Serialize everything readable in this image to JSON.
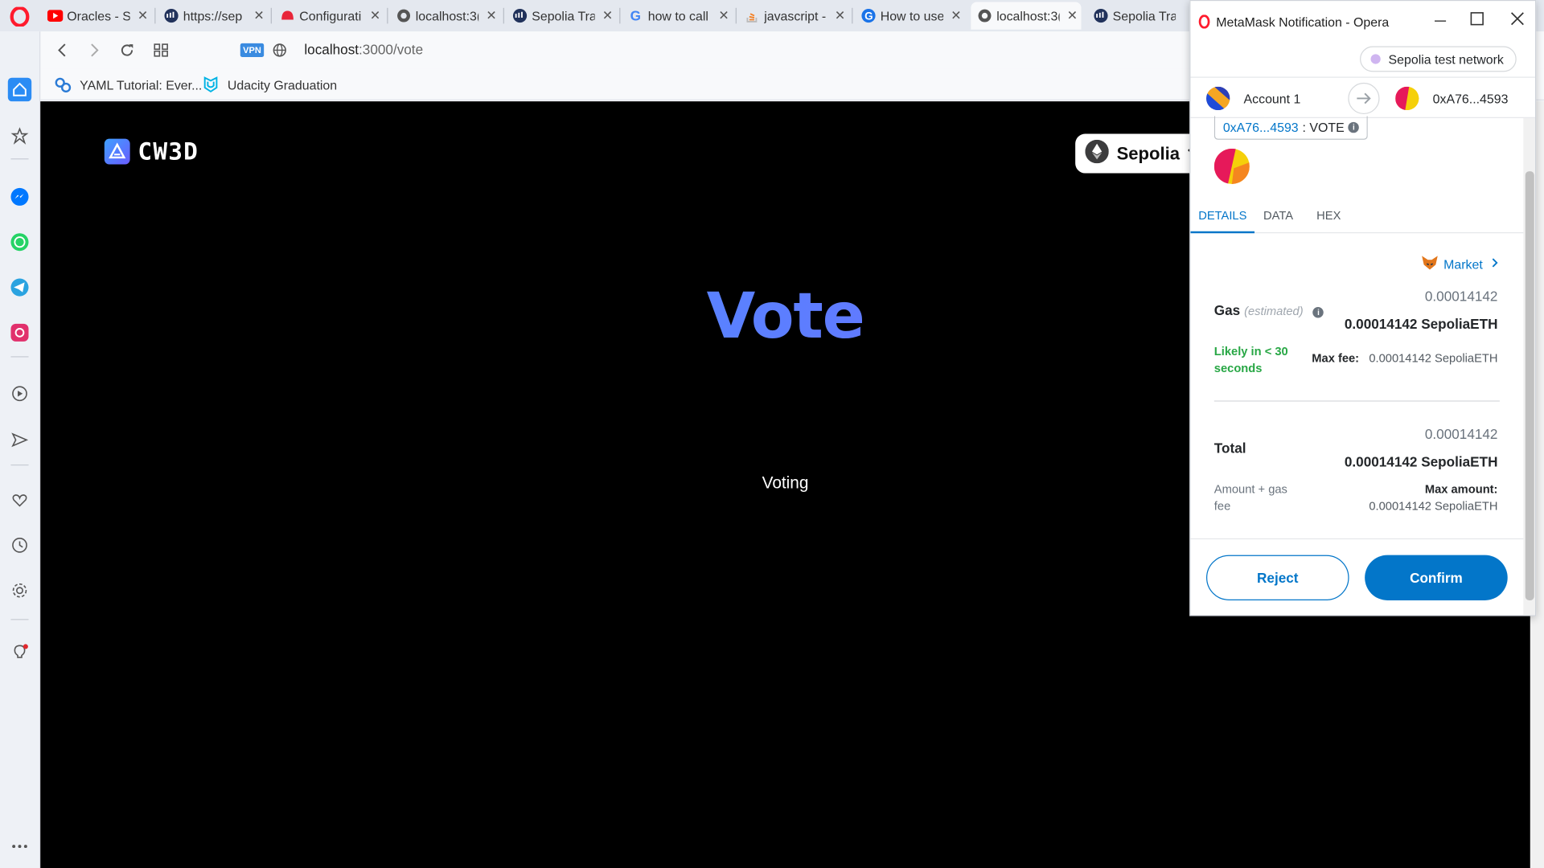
{
  "browser": {
    "tabs": [
      {
        "label": "Oracles - S",
        "icon": "youtube-icon"
      },
      {
        "label": "https://sep",
        "icon": "etherscan-icon"
      },
      {
        "label": "Configurati",
        "icon": "hardhat-icon"
      },
      {
        "label": "localhost:3(",
        "icon": "globe-icon"
      },
      {
        "label": "Sepolia Tra",
        "icon": "etherscan-icon"
      },
      {
        "label": "how to call",
        "icon": "google-icon"
      },
      {
        "label": "javascript -",
        "icon": "stackoverflow-icon"
      },
      {
        "label": "How to use",
        "icon": "google-icon"
      },
      {
        "label": "localhost:3(",
        "icon": "globe-icon"
      },
      {
        "label": "Sepolia Tra",
        "icon": "etherscan-icon"
      }
    ],
    "url_host": "localhost",
    "url_path": ":3000/vote",
    "vpn_label": "VPN",
    "bookmarks": [
      {
        "label": "YAML Tutorial: Ever..."
      },
      {
        "label": "Udacity Graduation"
      }
    ]
  },
  "page": {
    "logo_text": "CW3D",
    "network_label": "Sepolia",
    "title": "Vote",
    "status": "Voting"
  },
  "metamask": {
    "window_title": "MetaMask Notification - Opera",
    "network": "Sepolia test network",
    "from_account": "Account 1",
    "to_account": "0xA76...4593",
    "contract_address": "0xA76...4593",
    "contract_method": ": VOTE",
    "tabs": [
      "DETAILS",
      "DATA",
      "HEX"
    ],
    "market_label": "Market",
    "gas_label": "Gas",
    "gas_estimated": "(estimated)",
    "gas_sub": "0.00014142",
    "gas_main": "0.00014142 SepoliaETH",
    "likely_text": "Likely in < 30 seconds",
    "max_fee_label": "Max fee:",
    "max_fee_value": "0.00014142 SepoliaETH",
    "total_label": "Total",
    "total_sub": "0.00014142",
    "total_main": "0.00014142 SepoliaETH",
    "amount_gas_label": "Amount + gas fee",
    "max_amount_label": "Max amount:",
    "max_amount_value": "0.00014142 SepoliaETH",
    "reject_label": "Reject",
    "confirm_label": "Confirm"
  },
  "colors": {
    "metamask_blue": "#0376c9",
    "likely_green": "#28a745",
    "page_bg": "#000000"
  }
}
